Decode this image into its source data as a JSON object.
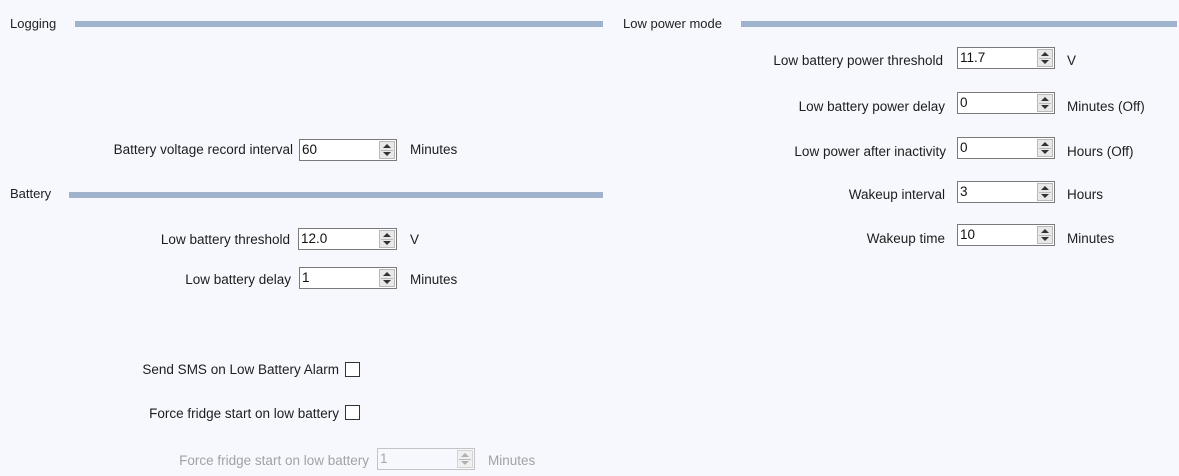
{
  "logging": {
    "title": "Logging",
    "battery_voltage_record_interval": {
      "label": "Battery voltage record interval",
      "value": "60",
      "unit": "Minutes"
    }
  },
  "battery": {
    "title": "Battery",
    "low_battery_threshold": {
      "label": "Low battery threshold",
      "value": "12.0",
      "unit": "V"
    },
    "low_battery_delay": {
      "label": "Low battery delay",
      "value": "1",
      "unit": "Minutes"
    },
    "send_sms": {
      "label": "Send SMS on Low Battery Alarm",
      "checked": false
    },
    "force_fridge_start": {
      "label": "Force fridge start on low battery",
      "checked": false
    },
    "force_fridge_delay": {
      "label": "Force fridge start on low battery",
      "value": "1",
      "unit": "Minutes",
      "disabled": true
    }
  },
  "low_power_mode": {
    "title": "Low power mode",
    "low_battery_power_threshold": {
      "label": "Low battery power threshold",
      "value": "11.7",
      "unit": "V"
    },
    "low_battery_power_delay": {
      "label": "Low battery power delay",
      "value": "0",
      "unit": "Minutes (Off)"
    },
    "low_power_after_inactivity": {
      "label": "Low power after inactivity",
      "value": "0",
      "unit": "Hours (Off)"
    },
    "wakeup_interval": {
      "label": "Wakeup interval",
      "value": "3",
      "unit": "Hours"
    },
    "wakeup_time": {
      "label": "Wakeup time",
      "value": "10",
      "unit": "Minutes"
    }
  },
  "colors": {
    "background": "#f6f8fd",
    "section_bar": "#9fb4cc",
    "disabled_text": "#a2a2a2"
  }
}
